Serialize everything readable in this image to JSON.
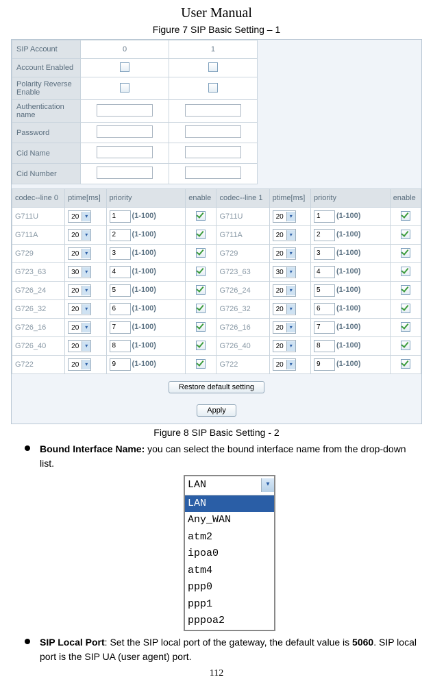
{
  "doc_title": "User Manual",
  "figure_caption_1": "Figure 7 SIP Basic Setting – 1",
  "figure_caption_2": "Figure 8 SIP Basic Setting - 2",
  "page_number": "112",
  "account": {
    "rows": [
      {
        "label": "SIP Account",
        "val0": "0",
        "val1": "1"
      },
      {
        "label": "Account Enabled"
      },
      {
        "label": "Polarity Reverse Enable"
      },
      {
        "label": "Authentication name"
      },
      {
        "label": "Password"
      },
      {
        "label": "Cid Name"
      },
      {
        "label": "Cid Number"
      }
    ]
  },
  "codec": {
    "headers": {
      "line0": "codec--line 0",
      "line1": "codec--line 1",
      "ptime": "ptime[ms]",
      "priority": "priority",
      "enable": "enable"
    },
    "priority_hint": "(1-100)",
    "rows": [
      {
        "name": "G711U",
        "ptime": "20",
        "priority": "1"
      },
      {
        "name": "G711A",
        "ptime": "20",
        "priority": "2"
      },
      {
        "name": "G729",
        "ptime": "20",
        "priority": "3"
      },
      {
        "name": "G723_63",
        "ptime": "30",
        "priority": "4"
      },
      {
        "name": "G726_24",
        "ptime": "20",
        "priority": "5"
      },
      {
        "name": "G726_32",
        "ptime": "20",
        "priority": "6"
      },
      {
        "name": "G726_16",
        "ptime": "20",
        "priority": "7"
      },
      {
        "name": "G726_40",
        "ptime": "20",
        "priority": "8"
      },
      {
        "name": "G722",
        "ptime": "20",
        "priority": "9"
      }
    ]
  },
  "buttons": {
    "restore": "Restore default setting",
    "apply": "Apply"
  },
  "body": {
    "item1_label": "Bound Interface Name:",
    "item1_text": " you can select the bound interface name from the drop-down list.",
    "item2_label": "SIP Local Port",
    "item2_text_a": ": Set the SIP local port of the gateway, the default value is ",
    "item2_default": "5060",
    "item2_text_b": ". SIP local port is the SIP UA (user agent) port."
  },
  "dropdown": {
    "selected": "LAN",
    "options": [
      "LAN",
      "Any_WAN",
      "atm2",
      "ipoa0",
      "atm4",
      "ppp0",
      "ppp1",
      "pppoa2"
    ]
  },
  "icons": {
    "chevron_down": "▾"
  }
}
